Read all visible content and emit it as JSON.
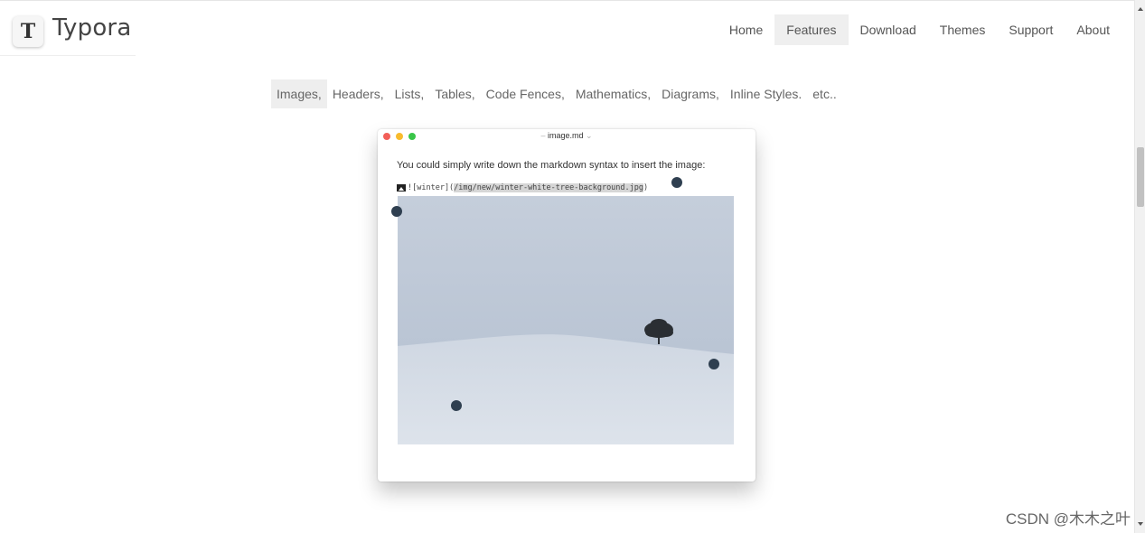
{
  "header": {
    "logo_letter": "T",
    "brand": "Typora",
    "nav": [
      {
        "label": "Home"
      },
      {
        "label": "Features",
        "active": true
      },
      {
        "label": "Download"
      },
      {
        "label": "Themes"
      },
      {
        "label": "Support"
      },
      {
        "label": "About"
      }
    ]
  },
  "features": [
    {
      "label": "Images,",
      "active": true
    },
    {
      "label": "Headers,"
    },
    {
      "label": "Lists,"
    },
    {
      "label": "Tables,"
    },
    {
      "label": "Code Fences,"
    },
    {
      "label": "Mathematics,"
    },
    {
      "label": "Diagrams,"
    },
    {
      "label": "Inline Styles."
    },
    {
      "label": "etc.."
    }
  ],
  "demo_window": {
    "filename": "image.md",
    "intro": "You could simply write down the markdown syntax to insert the image:",
    "code_prefix": "![winter](",
    "code_path": "/img/new/winter-white-tree-background.jpg",
    "code_suffix": ")"
  },
  "watermark": "CSDN @木木之叶",
  "colors": {
    "close": "#f25f58",
    "minimize": "#f8bb2e",
    "maximize": "#39c548",
    "handle": "#2f3f50"
  }
}
